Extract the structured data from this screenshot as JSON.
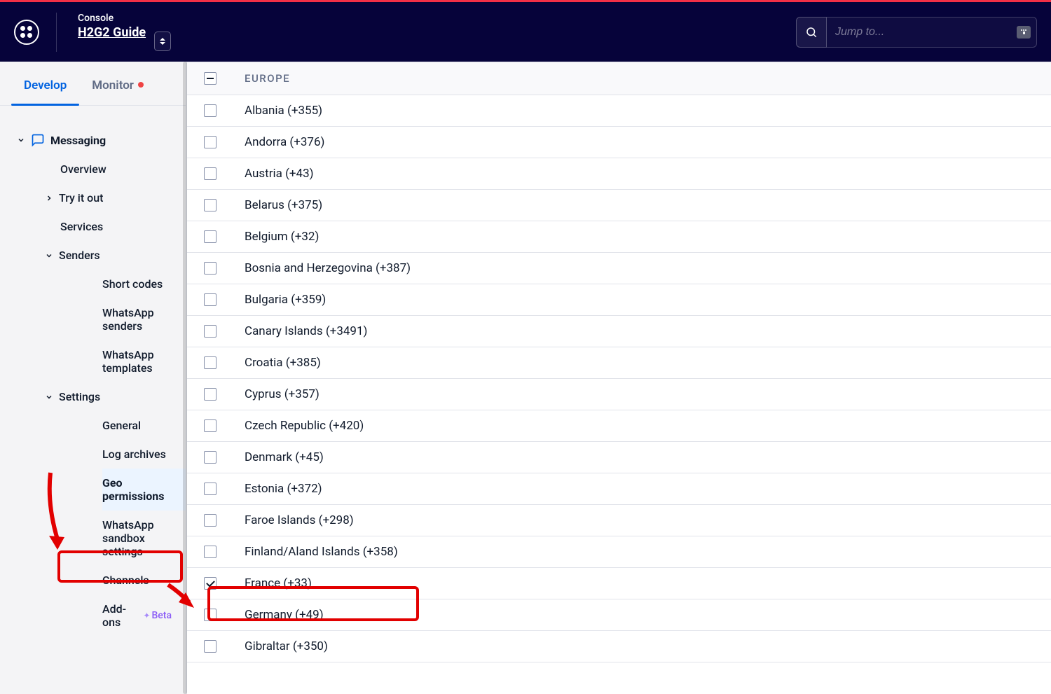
{
  "header": {
    "console_label": "Console",
    "account_name": "H2G2 Guide",
    "search_placeholder": "Jump to..."
  },
  "tabs": {
    "develop": "Develop",
    "monitor": "Monitor"
  },
  "sidebar": {
    "messaging": "Messaging",
    "overview": "Overview",
    "try_it_out": "Try it out",
    "services": "Services",
    "senders": "Senders",
    "short_codes": "Short codes",
    "whatsapp_senders": "WhatsApp senders",
    "whatsapp_templates": "WhatsApp templates",
    "settings": "Settings",
    "general": "General",
    "log_archives": "Log archives",
    "geo_permissions": "Geo permissions",
    "whatsapp_sandbox": "WhatsApp sandbox settings",
    "channels": "Channels",
    "addons": "Add-ons",
    "beta_label": "Beta"
  },
  "region": {
    "name": "EUROPE"
  },
  "countries": [
    {
      "name": "Albania",
      "code": "(+355)",
      "checked": false
    },
    {
      "name": "Andorra",
      "code": "(+376)",
      "checked": false
    },
    {
      "name": "Austria",
      "code": "(+43)",
      "checked": false
    },
    {
      "name": "Belarus",
      "code": "(+375)",
      "checked": false
    },
    {
      "name": "Belgium",
      "code": "(+32)",
      "checked": false
    },
    {
      "name": "Bosnia and Herzegovina",
      "code": "(+387)",
      "checked": false
    },
    {
      "name": "Bulgaria",
      "code": "(+359)",
      "checked": false
    },
    {
      "name": "Canary Islands",
      "code": "(+3491)",
      "checked": false
    },
    {
      "name": "Croatia",
      "code": "(+385)",
      "checked": false
    },
    {
      "name": "Cyprus",
      "code": "(+357)",
      "checked": false
    },
    {
      "name": "Czech Republic",
      "code": "(+420)",
      "checked": false
    },
    {
      "name": "Denmark",
      "code": "(+45)",
      "checked": false
    },
    {
      "name": "Estonia",
      "code": "(+372)",
      "checked": false
    },
    {
      "name": "Faroe Islands",
      "code": "(+298)",
      "checked": false
    },
    {
      "name": "Finland/Aland Islands",
      "code": "(+358)",
      "checked": false
    },
    {
      "name": "France",
      "code": "(+33)",
      "checked": true
    },
    {
      "name": "Germany",
      "code": "(+49)",
      "checked": false
    },
    {
      "name": "Gibraltar",
      "code": "(+350)",
      "checked": false
    }
  ]
}
